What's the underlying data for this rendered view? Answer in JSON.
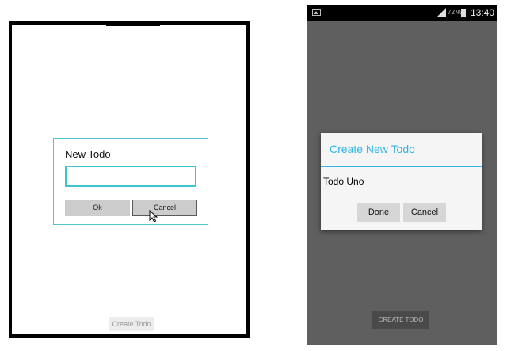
{
  "windows": {
    "dialog": {
      "title": "New Todo",
      "input_value": "",
      "ok_label": "Ok",
      "cancel_label": "Cancel"
    },
    "create_button_label": "Create Todo",
    "accent_color": "#3cc7cf"
  },
  "android": {
    "status_bar": {
      "battery_percent": "72 %",
      "time": "13:40"
    },
    "dialog": {
      "title": "Create New Todo",
      "input_value": "Todo Uno",
      "done_label": "Done",
      "cancel_label": "Cancel"
    },
    "create_button_label": "CREATE TODO",
    "title_color": "#33b5e5",
    "underline_color": "#e91e63"
  }
}
